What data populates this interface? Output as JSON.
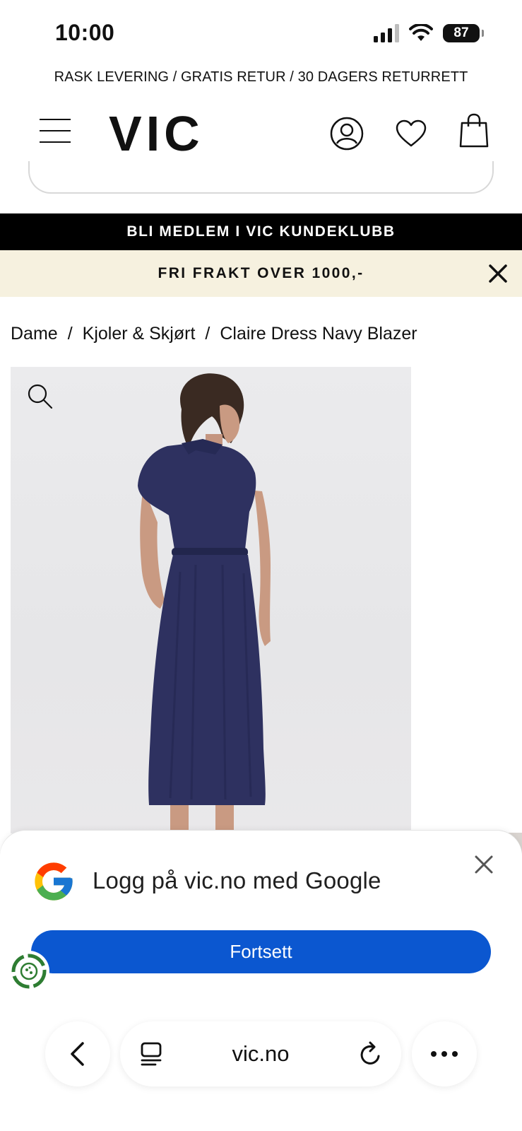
{
  "status_bar": {
    "time": "10:00",
    "battery": "87"
  },
  "top_banner": {
    "text": "RASK LEVERING / GRATIS RETUR / 30 DAGERS RETURRETT"
  },
  "header": {
    "logo": "VIC"
  },
  "member_bar": {
    "text": "BLI MEDLEM I VIC KUNDEKLUBB"
  },
  "shipping_bar": {
    "text": "FRI FRAKT OVER 1000,-"
  },
  "breadcrumb": {
    "items": [
      {
        "label": "Dame"
      },
      {
        "label": "Kjoler & Skjørt"
      },
      {
        "label": "Claire Dress Navy Blazer"
      }
    ],
    "separator": "/"
  },
  "product": {
    "dress_color": "#2e3160"
  },
  "google_sheet": {
    "title": "Logg på vic.no med Google",
    "continue_label": "Fortsett",
    "button_color": "#0b57d0"
  },
  "browser_toolbar": {
    "url": "vic.no"
  }
}
